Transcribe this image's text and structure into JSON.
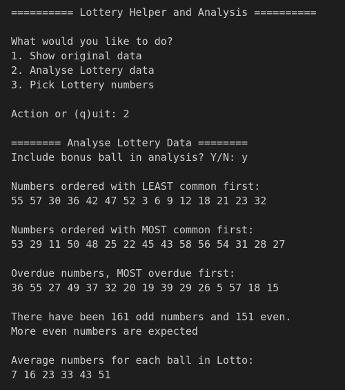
{
  "colors": {
    "background": "#1e1e1e",
    "text": "#cccccc"
  },
  "terminal": {
    "lines": [
      "========== Lottery Helper and Analysis ==========",
      "",
      "What would you like to do?",
      "1. Show original data",
      "2. Analyse Lottery data",
      "3. Pick Lottery numbers",
      "",
      "Action or (q)uit: 2",
      "",
      "======== Analyse Lottery Data ========",
      "Include bonus ball in analysis? Y/N: y",
      "",
      "Numbers ordered with LEAST common first:",
      "55 57 30 36 42 47 52 3 6 9 12 18 21 23 32",
      "",
      "Numbers ordered with MOST common first:",
      "53 29 11 50 48 25 22 45 43 58 56 54 31 28 27",
      "",
      "Overdue numbers, MOST overdue first:",
      "36 55 27 49 37 32 20 19 39 29 26 5 57 18 15",
      "",
      "There have been 161 odd numbers and 151 even.",
      "More even numbers are expected",
      "",
      "Average numbers for each ball in Lotto:",
      "7 16 23 33 43 51"
    ]
  }
}
